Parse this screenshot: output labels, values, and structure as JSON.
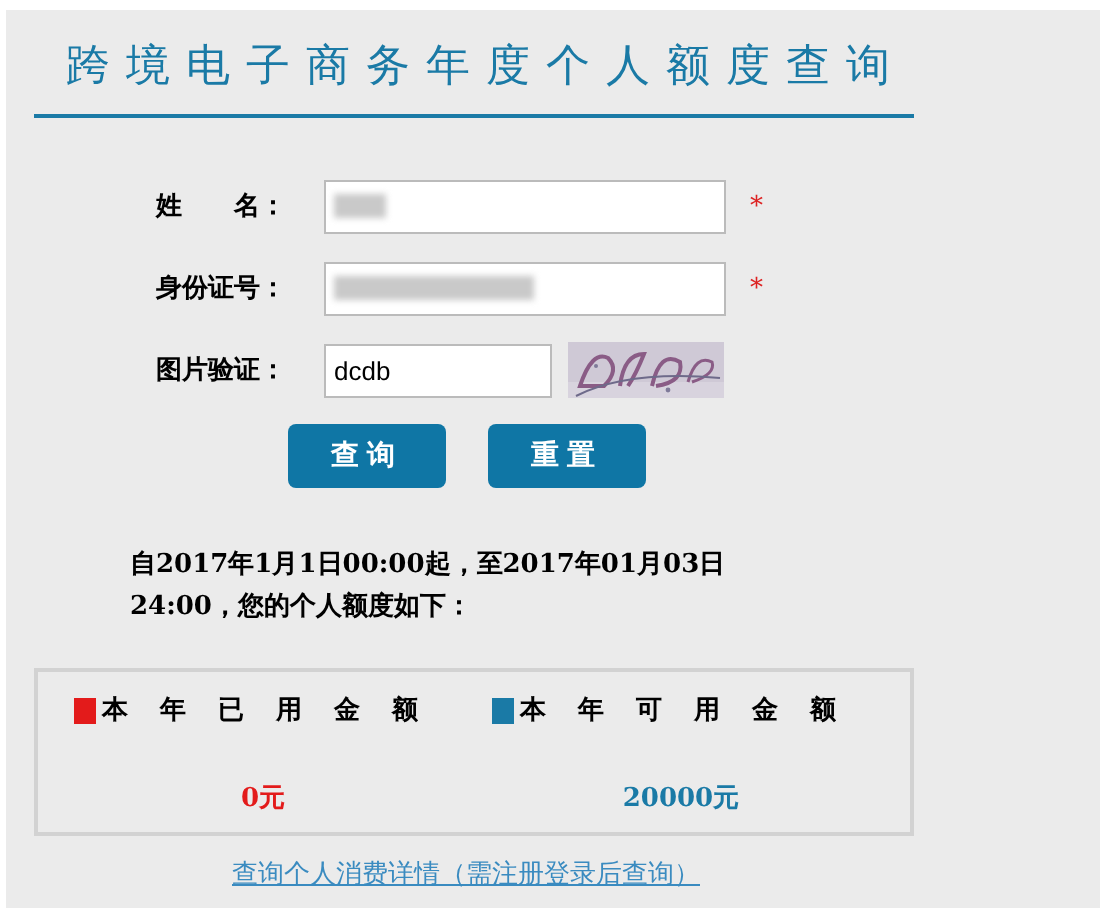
{
  "title": "跨境电子商务年度个人额度查询",
  "fields": [
    {
      "label": "姓　　名：",
      "kind": "redacted",
      "mark": "*"
    },
    {
      "label": "身份证号：",
      "kind": "redacted",
      "mark": "*"
    },
    {
      "label": "图片验证：",
      "kind": "captcha",
      "value": "dcdb"
    }
  ],
  "buttons": [
    "查询",
    "重置"
  ],
  "notice": "自2017年1月1日00:00起，至2017年01月03日24:00，您的个人额度如下：",
  "stats": [
    {
      "label": "本年已用金额",
      "value": "0元",
      "color": "#e31b1b"
    },
    {
      "label": "本年可用金额",
      "value": "20000元",
      "color": "#1a7aa6"
    }
  ],
  "link": "查询个人消费详情（需注册登录后查询）"
}
